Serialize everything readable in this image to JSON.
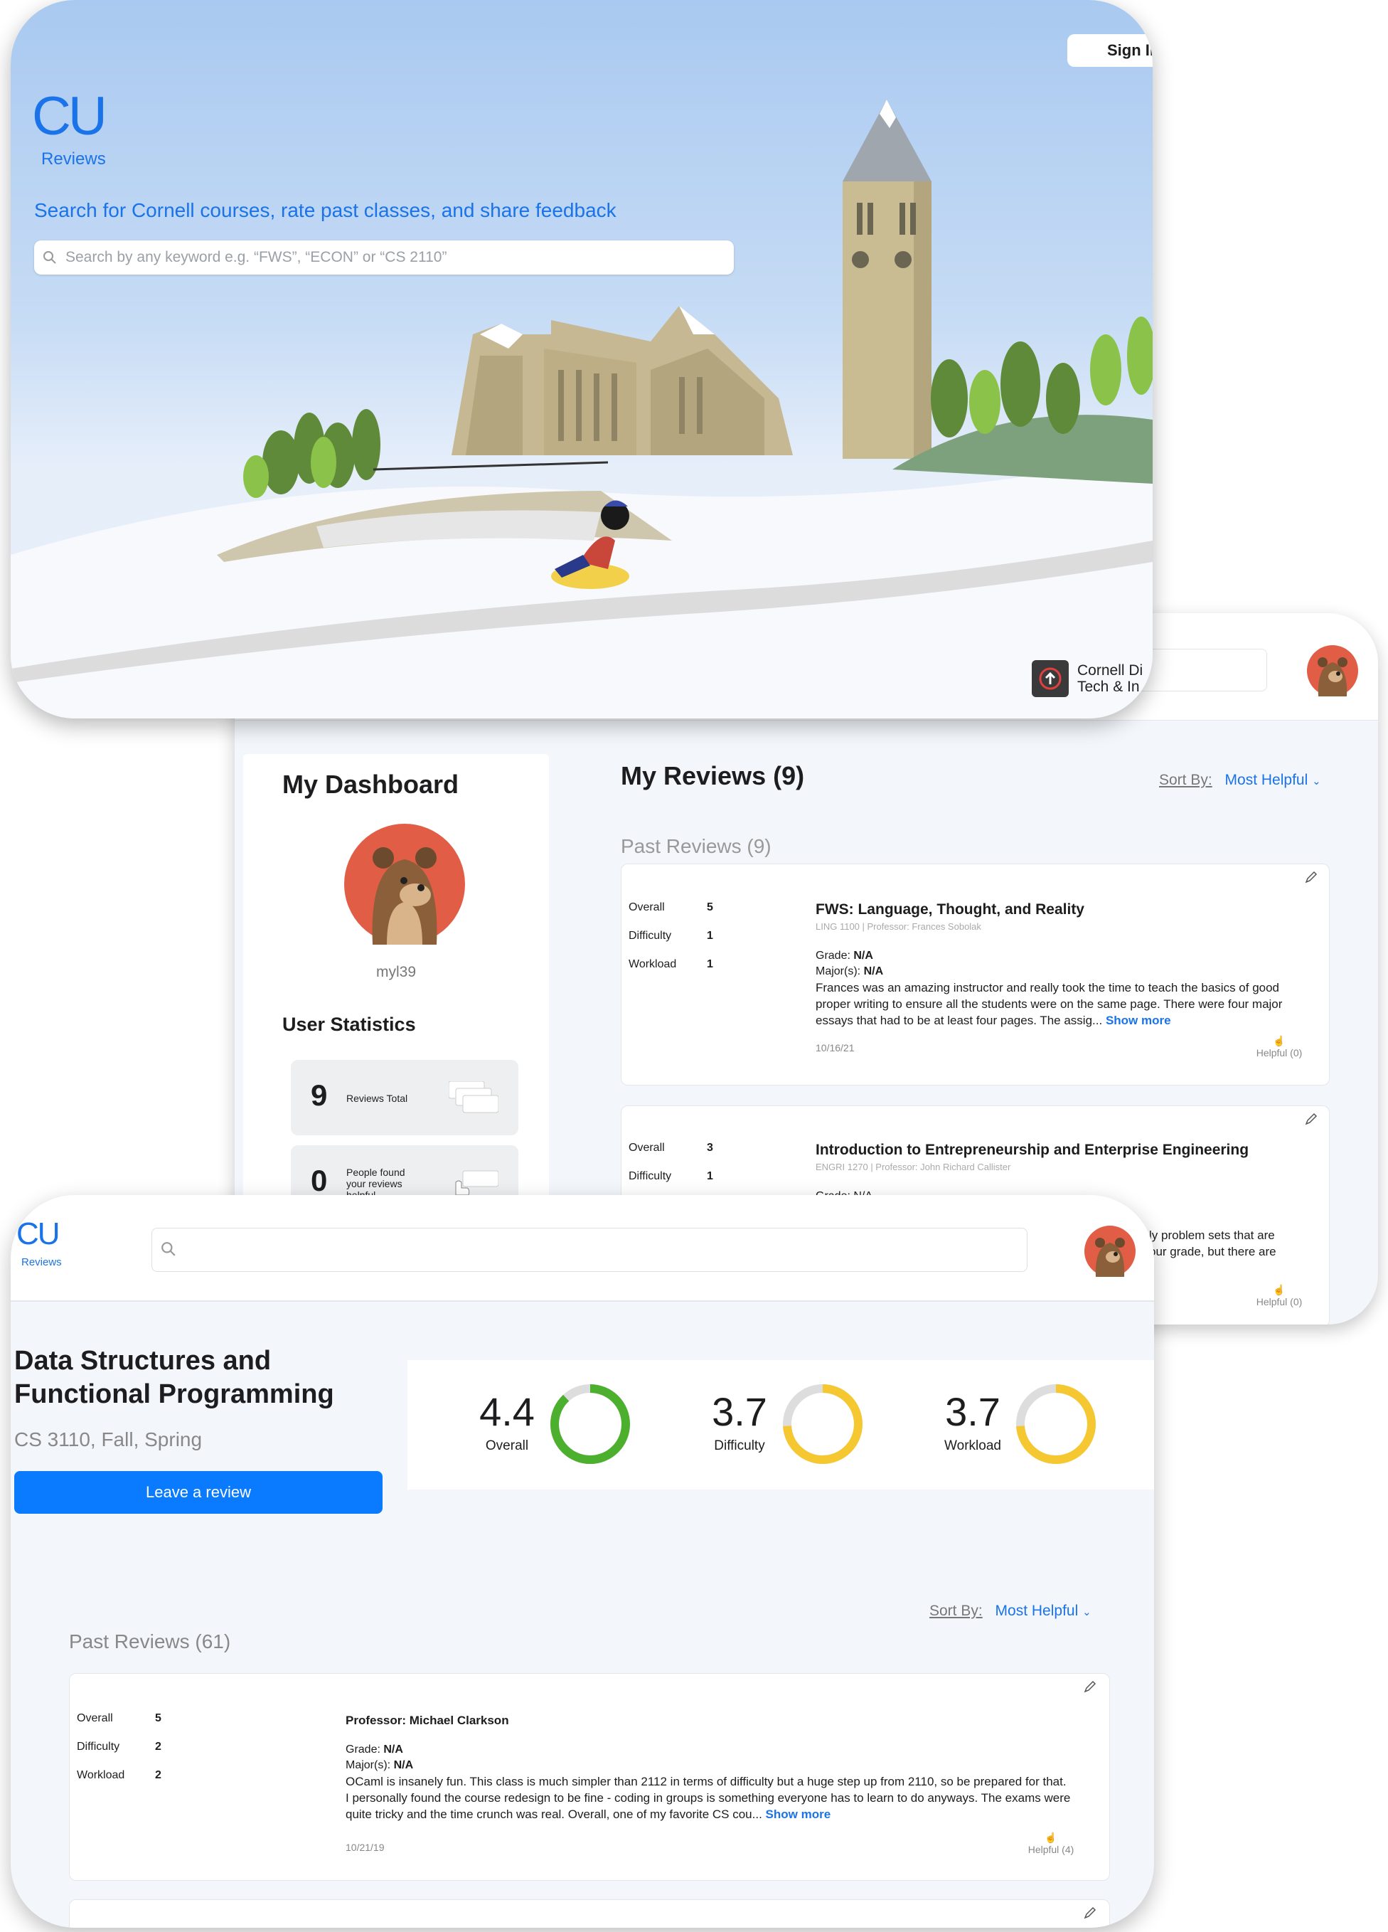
{
  "hero": {
    "logo_cu": "CU",
    "logo_reviews": "Reviews",
    "tagline": "Search for Cornell courses, rate past classes, and share feedback",
    "search_placeholder": "Search by any keyword e.g. “FWS”, “ECON” or “CS 2110”",
    "signin_label": "Sign In",
    "footer_org_line1": "Cornell Di",
    "footer_org_line2": "Tech & In"
  },
  "dashboard": {
    "title": "My Dashboard",
    "username": "myl39",
    "stats_heading": "User Statistics",
    "stats": [
      {
        "value": "9",
        "label": "Reviews Total"
      },
      {
        "value": "0",
        "label": "People found your reviews helpful"
      }
    ],
    "my_reviews_heading": "My Reviews (9)",
    "sort_label": "Sort By:",
    "sort_value": "Most Helpful",
    "past_reviews_heading": "Past Reviews (9)",
    "reviews": [
      {
        "overall_label": "Overall",
        "overall": "5",
        "difficulty_label": "Difficulty",
        "difficulty": "1",
        "workload_label": "Workload",
        "workload": "1",
        "title": "FWS: Language, Thought, and Reality",
        "subtitle": "LING 1100 | Professor: Frances Sobolak",
        "grade_label": "Grade:",
        "grade": "N/A",
        "major_label": "Major(s):",
        "major": "N/A",
        "body": "Frances was an amazing instructor and really took the time to teach the basics of good proper writing to ensure all the students were on the same page. There were four major essays that had to be at least four pages. The assig...",
        "show_more": "Show more",
        "date": "10/16/21",
        "helpful": "Helpful (0)"
      },
      {
        "overall_label": "Overall",
        "overall": "3",
        "difficulty_label": "Difficulty",
        "difficulty": "1",
        "title": "Introduction to Entrepreneurship and Enterprise Engineering",
        "subtitle": "ENGRI 1270 | Professor: John Richard Callister",
        "grade_partial": "Grade: N/A",
        "body_line1": "ly problem sets that are",
        "body_line2": "our grade, but there are",
        "helpful": "Helpful (0)"
      }
    ]
  },
  "course": {
    "logo_cu": "CU",
    "logo_reviews": "Reviews",
    "title": "Data Structures and Functional Programming",
    "code": "CS 3110, Fall, Spring",
    "leave_review": "Leave a review",
    "ratings": [
      {
        "label": "Overall",
        "value": "4.4",
        "score": 4.4,
        "color": "#4caf2e"
      },
      {
        "label": "Difficulty",
        "value": "3.7",
        "score": 3.7,
        "color": "#f5c832"
      },
      {
        "label": "Workload",
        "value": "3.7",
        "score": 3.7,
        "color": "#f5c832"
      }
    ],
    "sort_label": "Sort By:",
    "sort_value": "Most Helpful",
    "past_reviews_heading": "Past Reviews (61)",
    "review": {
      "overall_label": "Overall",
      "overall": "5",
      "difficulty_label": "Difficulty",
      "difficulty": "2",
      "workload_label": "Workload",
      "workload": "2",
      "professor": "Professor: Michael Clarkson",
      "grade_label": "Grade:",
      "grade": "N/A",
      "major_label": "Major(s):",
      "major": "N/A",
      "body": "OCaml is insanely fun. This class is much simpler than 2112 in terms of difficulty but a huge step up from 2110, so be prepared for that. I personally found the course redesign to be fine - coding in groups is something everyone has to learn to do anyways. The exams were quite tricky and the time crunch was real. Overall, one of my favorite CS cou...",
      "show_more": "Show more",
      "date": "10/21/19",
      "helpful": "Helpful (4)"
    }
  },
  "colors": {
    "accent": "#1a73e8",
    "button": "#0a7bff",
    "avatar_bg": "#e15d46"
  }
}
